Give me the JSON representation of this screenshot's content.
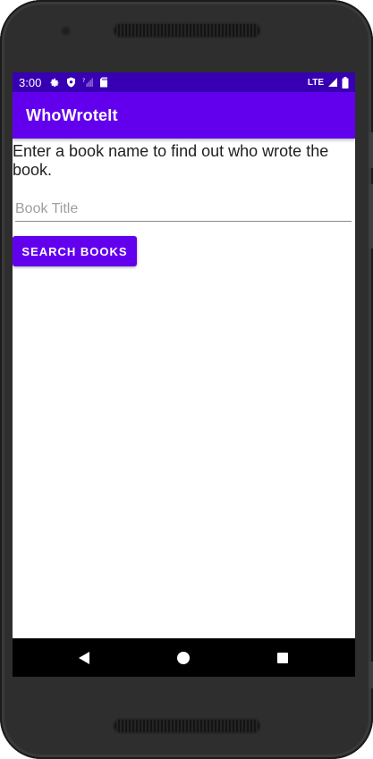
{
  "status_bar": {
    "time": "3:00",
    "network": "LTE",
    "icons_left": [
      "gear-icon",
      "shield-icon",
      "no-sim-signal-icon",
      "sd-card-icon"
    ],
    "icons_right": [
      "signal-icon",
      "battery-icon"
    ]
  },
  "app_bar": {
    "title": "WhoWroteIt",
    "color": "#6200ee",
    "status_color": "#3700b3"
  },
  "main": {
    "instructions": "Enter a book name to find out who wrote the book.",
    "book_input": {
      "placeholder": "Book Title",
      "value": ""
    },
    "search_button_label": "SEARCH BOOKS"
  },
  "nav_bar": {
    "buttons": [
      "back-icon",
      "home-icon",
      "recents-icon"
    ]
  }
}
